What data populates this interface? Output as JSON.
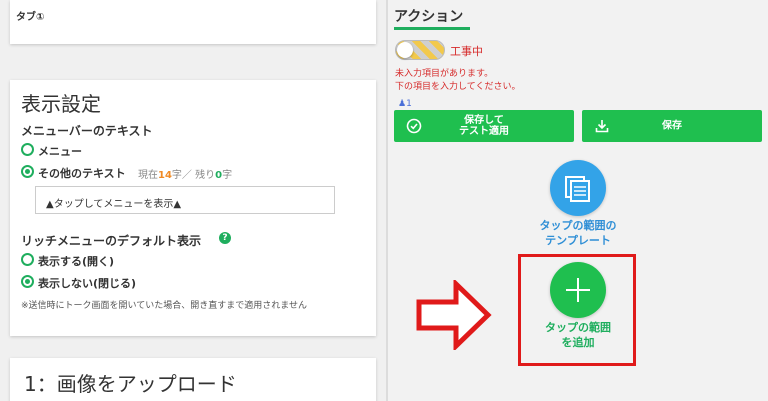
{
  "left": {
    "tab_card": {
      "label": "タブ①"
    },
    "display_settings": {
      "title": "表示設定",
      "menubar_text_label": "メニューバーのテキスト",
      "option_menu": "メニュー",
      "option_other": "その他のテキスト",
      "counter": {
        "current_label": "現在",
        "current": "14",
        "unit1": "字／ 残り",
        "remaining": "0",
        "unit2": "字"
      },
      "text_value": "▲タップしてメニューを表示▲",
      "rich_default_label": "リッチメニューのデフォルト表示",
      "help_icon": "?",
      "option_show": "表示する(開く)",
      "option_hide": "表示しない(閉じる)",
      "note": "※送信時にトーク画面を開いていた場合、開き直すまで適用されません"
    },
    "upload_card": {
      "title": "1：画像をアップロード"
    }
  },
  "right": {
    "action_title": "アクション",
    "toggle_label": "工事中",
    "warning_line1": "未入力項目があります。",
    "warning_line2": "下の項目を入力してください。",
    "user_count": "1",
    "buttons": {
      "save_test": "保存して\nテスト適用",
      "save": "保存"
    },
    "template_caption": "タップの範囲の\nテンプレート",
    "add_caption": "タップの範囲\nを追加",
    "add_symbol": "+"
  },
  "colors": {
    "accent_green": "#1fbf4f",
    "template_blue": "#33a3e8",
    "warning_red": "#d62b2b",
    "highlight_red": "#e01a1a"
  },
  "icons": [
    "help-icon",
    "check-circle-icon",
    "download-icon",
    "copy-template-icon",
    "plus-icon",
    "user-icon",
    "arrow-right-icon"
  ]
}
